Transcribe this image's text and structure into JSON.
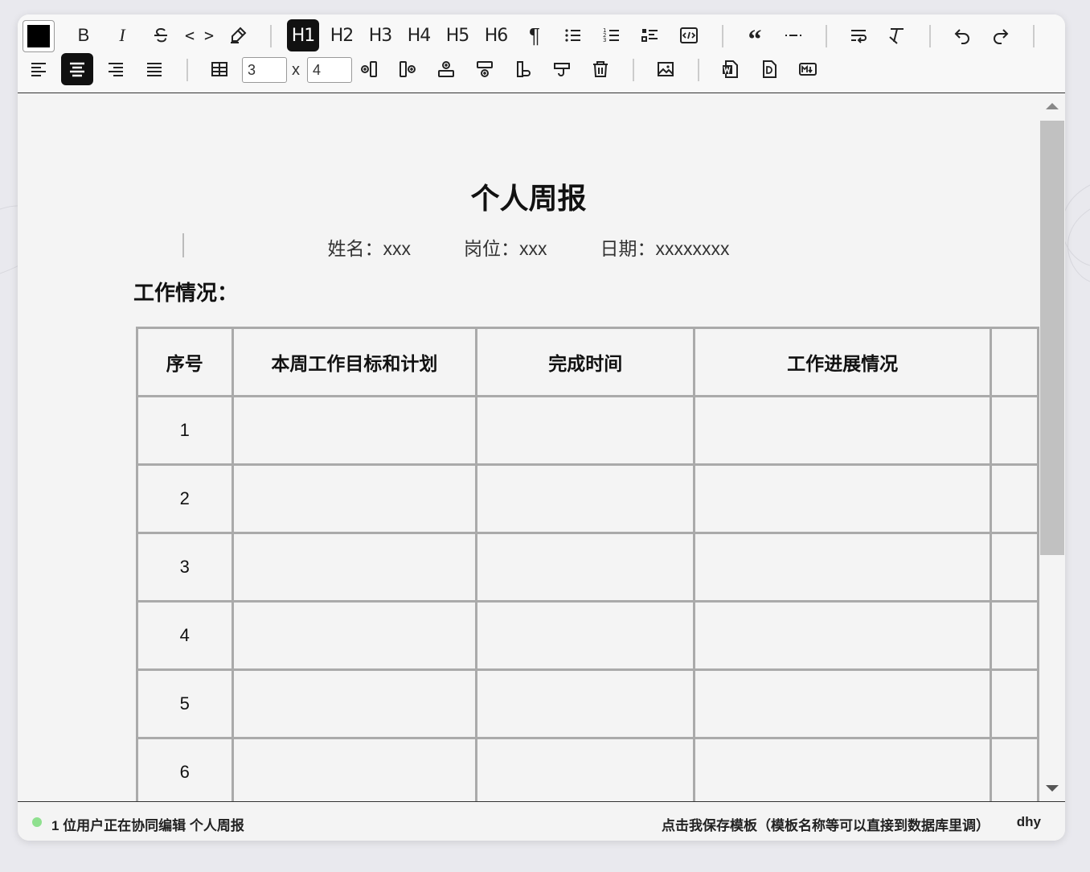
{
  "toolbar": {
    "row1": {
      "text_color": "#000000",
      "bold": "B",
      "italic": "I",
      "code": "< >",
      "headings": [
        "H1",
        "H2",
        "H3",
        "H4",
        "H5",
        "H6"
      ],
      "active_heading": "H1"
    },
    "row2": {
      "table_rows": "3",
      "times": "x",
      "table_cols": "4",
      "active_align": "center"
    }
  },
  "document": {
    "title": "个人周报",
    "meta": [
      "姓名：xxx",
      "岗位：xxx",
      "日期：xxxxxxxx"
    ],
    "section_title": "工作情况：",
    "table": {
      "headers": [
        "序号",
        "本周工作目标和计划",
        "完成时间",
        "工作进展情况",
        ""
      ],
      "rows": [
        [
          "1",
          "",
          "",
          "",
          ""
        ],
        [
          "2",
          "",
          "",
          "",
          ""
        ],
        [
          "3",
          "",
          "",
          "",
          ""
        ],
        [
          "4",
          "",
          "",
          "",
          ""
        ],
        [
          "5",
          "",
          "",
          "",
          ""
        ],
        [
          "6",
          "",
          "",
          "",
          ""
        ]
      ]
    }
  },
  "statusbar": {
    "online_color": "#8fe08f",
    "collab_text": "1 位用户正在协同编辑 个人周报",
    "save_text": "点击我保存模板（模板名称等可以直接到数据库里调）",
    "user": "dhy"
  }
}
